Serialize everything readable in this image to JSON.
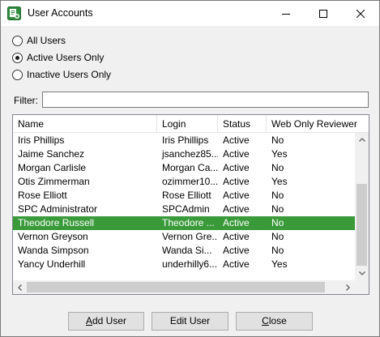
{
  "window": {
    "title": "User Accounts",
    "accent_color": "#3a9a3a"
  },
  "filter_options": [
    {
      "label": "All Users",
      "checked": false
    },
    {
      "label": "Active Users Only",
      "checked": true
    },
    {
      "label": "Inactive Users Only",
      "checked": false
    }
  ],
  "filter": {
    "label": "Filter:",
    "value": ""
  },
  "table": {
    "columns": [
      "Name",
      "Login",
      "Status",
      "Web Only Reviewer"
    ],
    "rows": [
      {
        "name": "Iris Phillips",
        "login": "Iris Phillips",
        "status": "Active",
        "web_only": "No"
      },
      {
        "name": "Jaime Sanchez",
        "login": "jsanchez85...",
        "status": "Active",
        "web_only": "Yes"
      },
      {
        "name": "Morgan Carlisle",
        "login": "Morgan Ca...",
        "status": "Active",
        "web_only": "No"
      },
      {
        "name": "Otis Zimmerman",
        "login": "ozimmer10...",
        "status": "Active",
        "web_only": "Yes"
      },
      {
        "name": "Rose Elliott",
        "login": "Rose Elliott",
        "status": "Active",
        "web_only": "No"
      },
      {
        "name": "SPC Administrator",
        "login": "SPCAdmin",
        "status": "Active",
        "web_only": "No"
      },
      {
        "name": "Theodore Russell",
        "login": "Theodore ...",
        "status": "Active",
        "web_only": "No",
        "selected": true
      },
      {
        "name": "Vernon Greyson",
        "login": "Vernon Gre...",
        "status": "Active",
        "web_only": "No"
      },
      {
        "name": "Wanda Simpson",
        "login": "Wanda Si...",
        "status": "Active",
        "web_only": "No"
      },
      {
        "name": "Yancy Underhill",
        "login": "underhilly6...",
        "status": "Active",
        "web_only": "Yes"
      }
    ]
  },
  "buttons": {
    "add": {
      "mnemonic": "A",
      "rest": "dd User"
    },
    "edit": {
      "label": "Edit User"
    },
    "close": {
      "mnemonic": "C",
      "rest": "lose"
    }
  }
}
